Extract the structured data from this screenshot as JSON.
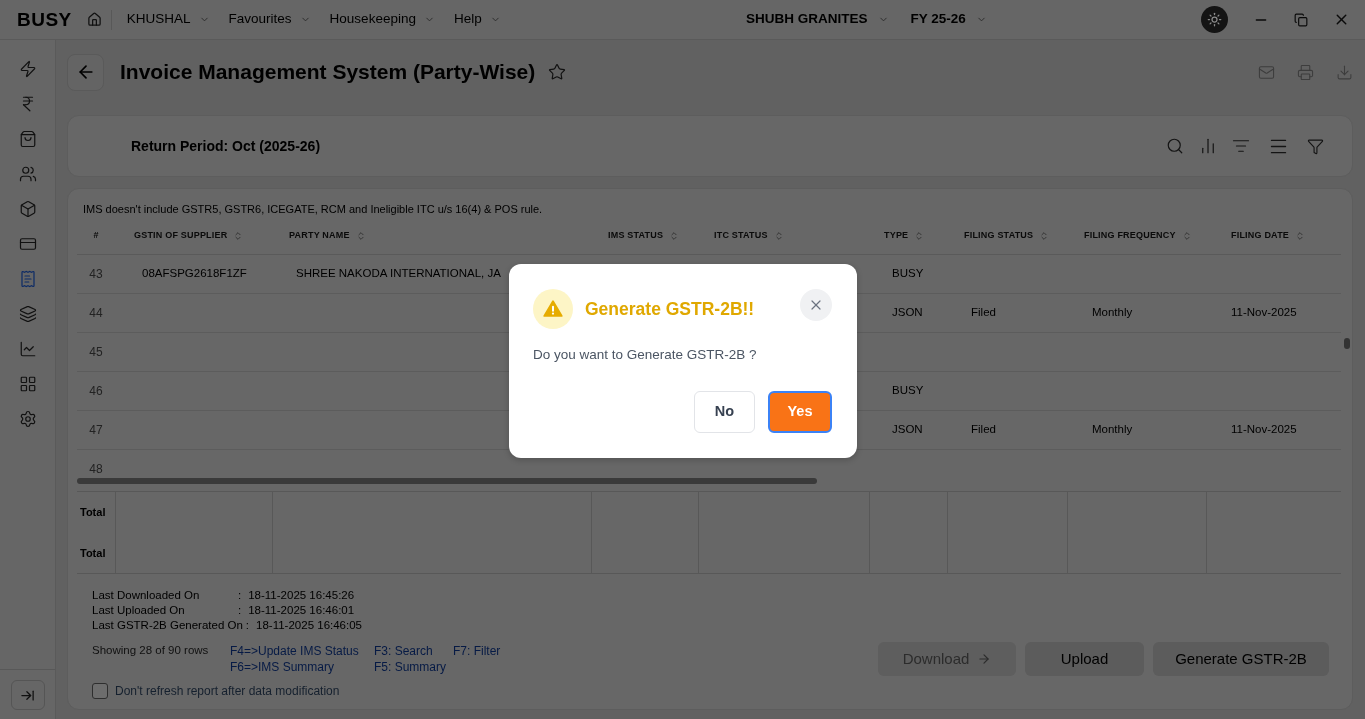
{
  "top_bar": {
    "logo": "BUSY",
    "menus": [
      {
        "label": "KHUSHAL"
      },
      {
        "label": "Favourites"
      },
      {
        "label": "Housekeeping"
      },
      {
        "label": "Help"
      }
    ],
    "company": "SHUBH GRANITES",
    "fiscal_year": "FY 25-26"
  },
  "sidebar": {
    "items": [
      {
        "selected": false
      },
      {
        "selected": false
      },
      {
        "selected": false
      },
      {
        "selected": false
      },
      {
        "selected": false
      },
      {
        "selected": false
      },
      {
        "selected": true
      },
      {
        "selected": false
      },
      {
        "selected": false
      },
      {
        "selected": false
      },
      {
        "selected": false
      }
    ]
  },
  "page": {
    "title": "Invoice Management System (Party-Wise)"
  },
  "period_card": {
    "label": "Return Period: Oct (2025-26)"
  },
  "table": {
    "note": "IMS doesn't include GSTR5, GSTR6, ICEGATE, RCM and Ineligible ITC u/s 16(4) & POS rule.",
    "columns": [
      {
        "label": "#",
        "sortable": false
      },
      {
        "label": "GSTIN OF SUPPLIER",
        "sortable": true
      },
      {
        "label": "PARTY NAME",
        "sortable": true
      },
      {
        "label": "IMS STATUS",
        "sortable": true
      },
      {
        "label": "ITC STATUS",
        "sortable": true
      },
      {
        "label": "TYPE",
        "sortable": true
      },
      {
        "label": "FILING STATUS",
        "sortable": true
      },
      {
        "label": "FILING FREQUENCY",
        "sortable": true
      },
      {
        "label": "FILING DATE",
        "sortable": true
      }
    ],
    "rows": [
      {
        "number": "43",
        "gstin": "08AFSPG2618F1ZF",
        "party_name": "SHREE NAKODA INTERNATIONAL, JA",
        "type": "BUSY"
      },
      {
        "number": "44",
        "type": "JSON",
        "filing_status": "Filed",
        "filing_frequency": "Monthly",
        "filing_date": "11-Nov-2025"
      },
      {
        "number": "45"
      },
      {
        "number": "46",
        "type": "BUSY"
      },
      {
        "number": "47",
        "type": "JSON",
        "filing_status": "Filed",
        "filing_frequency": "Monthly",
        "filing_date": "11-Nov-2025"
      },
      {
        "number": "48"
      }
    ],
    "totals": [
      "Total",
      "Total"
    ]
  },
  "footer": {
    "info": [
      {
        "label": "Last Downloaded On",
        "separator": ":",
        "value": "18-11-2025 16:45:26"
      },
      {
        "label": "Last Uploaded On",
        "separator": ":",
        "value": "18-11-2025 16:46:01"
      },
      {
        "label": "Last GSTR-2B Generated On",
        "separator": ":",
        "value": "18-11-2025 16:46:05"
      }
    ],
    "row_count": "Showing 28 of 90 rows",
    "shortcut_columns": [
      {
        "links": [
          "F4=>Update IMS Status",
          "F6=>IMS Summary"
        ]
      },
      {
        "links": [
          "F3: Search",
          "F5: Summary"
        ]
      },
      {
        "links": [
          "F7: Filter"
        ]
      }
    ],
    "checkbox": {
      "label": "Don't refresh report after data modification",
      "checked": false
    },
    "buttons": [
      {
        "label": "Download",
        "kind": "menu",
        "disabled": true
      },
      {
        "label": "Upload",
        "kind": "plain",
        "disabled": false
      },
      {
        "label": "Generate GSTR-2B",
        "kind": "plain",
        "disabled": false
      }
    ]
  },
  "dialog": {
    "title": "Generate GSTR-2B!!",
    "message": "Do you want to Generate GSTR-2B ?",
    "buttons": [
      {
        "label": "No",
        "kind": "secondary",
        "focused": false
      },
      {
        "label": "Yes",
        "kind": "primary",
        "focused": true
      }
    ]
  }
}
